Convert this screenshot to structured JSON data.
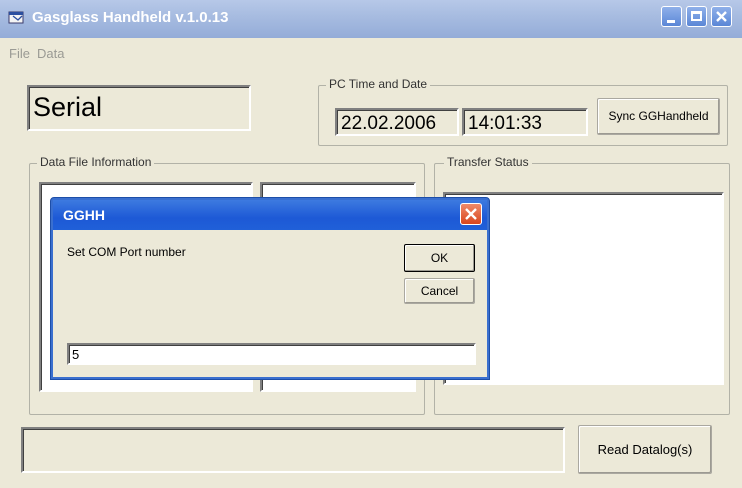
{
  "window": {
    "title": "Gasglass Handheld v.1.0.13"
  },
  "menu": {
    "items": [
      "File",
      "Data"
    ]
  },
  "mode_display": "Serial",
  "pc_time": {
    "group_label": "PC Time and Date",
    "date": "22.02.2006",
    "time": "14:01:33",
    "sync_button": "Sync GGHandheld"
  },
  "data_file": {
    "group_label": "Data File Information"
  },
  "transfer": {
    "group_label": "Transfer Status"
  },
  "status_bar": {
    "text": ""
  },
  "read_button": "Read Datalog(s)",
  "dialog": {
    "title": "GGHH",
    "prompt": "Set COM Port number",
    "ok_label": "OK",
    "cancel_label": "Cancel",
    "input_value": "5"
  },
  "colors": {
    "titlebar": "#a6bbe0",
    "dialog_titlebar": "#1d59d6",
    "close_red": "#e0542e",
    "face": "#ece9d8"
  }
}
